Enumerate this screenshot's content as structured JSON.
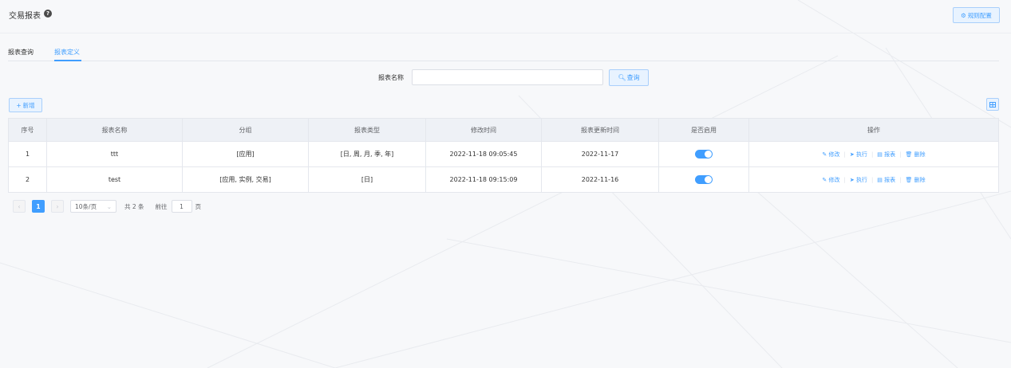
{
  "header": {
    "title": "交易报表",
    "help_icon": "?",
    "rule_button": {
      "icon": "⚙",
      "label": "规则配置"
    }
  },
  "tabs": [
    {
      "label": "报表查询",
      "active": false
    },
    {
      "label": "报表定义",
      "active": true
    }
  ],
  "search": {
    "label": "报表名称",
    "value": "",
    "placeholder": "",
    "button_icon": "🔍︎",
    "button_label": "查询"
  },
  "toolbar": {
    "add_icon": "+",
    "add_label": "新增"
  },
  "table": {
    "columns": [
      "序号",
      "报表名称",
      "分组",
      "报表类型",
      "修改时间",
      "报表更新时间",
      "是否启用",
      "操作"
    ],
    "rows": [
      {
        "index": "1",
        "name": "ttt",
        "group": "[应用]",
        "type": "[日, 周, 月, 季, 年]",
        "modified": "2022-11-18 09:05:45",
        "updated": "2022-11-17",
        "enabled": true
      },
      {
        "index": "2",
        "name": "test",
        "group": "[应用, 实例, 交易]",
        "type": "[日]",
        "modified": "2022-11-18 09:15:09",
        "updated": "2022-11-16",
        "enabled": true
      }
    ],
    "actions": {
      "edit": {
        "icon": "✎",
        "label": "修改"
      },
      "run": {
        "icon": "➤",
        "label": "执行"
      },
      "report": {
        "icon": "▤",
        "label": "报表"
      },
      "delete": {
        "icon": "🗑︎",
        "label": "删除"
      }
    }
  },
  "pagination": {
    "prev": "‹",
    "current": "1",
    "next": "›",
    "page_size": "10条/页",
    "total": "共 2 条",
    "goto_label": "前往",
    "goto_value": "1",
    "page_unit": "页"
  },
  "colors": {
    "accent": "#409eff",
    "accent_light": "#e8f3ff",
    "header_bg": "#eef1f6"
  }
}
